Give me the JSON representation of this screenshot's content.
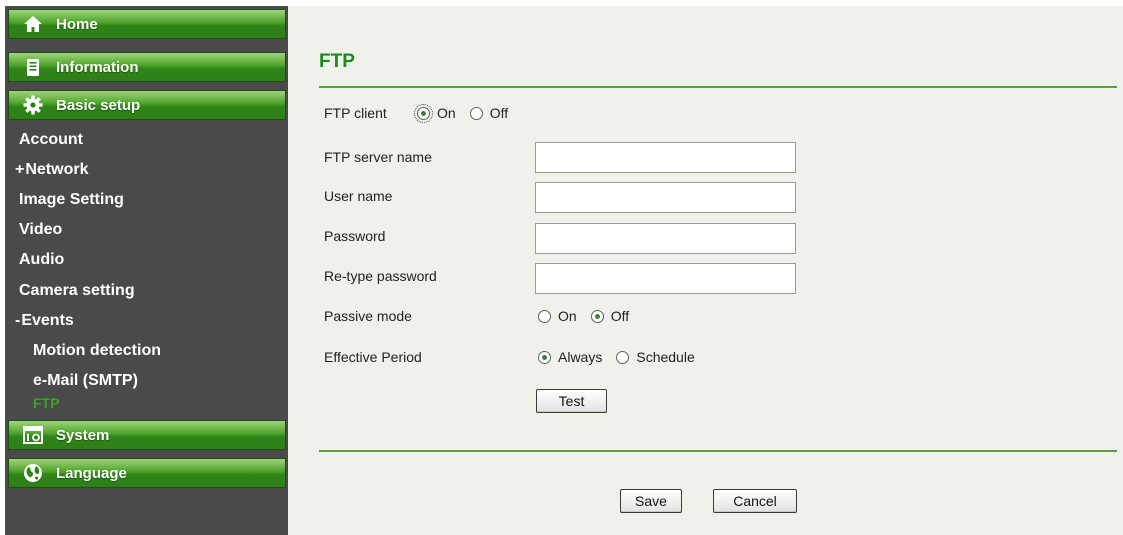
{
  "sidebar": {
    "home": "Home",
    "information": "Information",
    "basic_setup": "Basic setup",
    "items": {
      "account": "Account",
      "network": "Network",
      "network_sign": "+",
      "image_setting": "Image Setting",
      "video": "Video",
      "audio": "Audio",
      "camera_setting": "Camera setting",
      "events": "Events",
      "events_sign": "-",
      "motion_detection": "Motion detection",
      "email_smtp": "e-Mail (SMTP)",
      "ftp": "FTP"
    },
    "system": "System",
    "language": "Language"
  },
  "page": {
    "title": "FTP"
  },
  "form": {
    "ftp_client": {
      "label": "FTP client",
      "options": [
        "On",
        "Off"
      ],
      "selected": "On"
    },
    "ftp_server_name": {
      "label": "FTP server name",
      "value": ""
    },
    "user_name": {
      "label": "User name",
      "value": ""
    },
    "password": {
      "label": "Password",
      "value": ""
    },
    "retype_password": {
      "label": "Re-type password",
      "value": ""
    },
    "passive_mode": {
      "label": "Passive mode",
      "options": [
        "On",
        "Off"
      ],
      "selected": "Off"
    },
    "effective_period": {
      "label": "Effective Period",
      "options": [
        "Always",
        "Schedule"
      ],
      "selected": "Always"
    },
    "test_label": "Test"
  },
  "footer": {
    "save_label": "Save",
    "cancel_label": "Cancel"
  },
  "icons": {
    "home": "home-icon",
    "information": "information-icon",
    "basic_setup": "gear-icon",
    "system": "system-icon",
    "language": "globe-icon"
  },
  "colors": {
    "sidebar_bg": "#4a4a4a",
    "button_green": "#2f8419",
    "active_item": "#3da125",
    "title_green": "#1c8a1c",
    "panel_bg": "#eef2ea"
  }
}
